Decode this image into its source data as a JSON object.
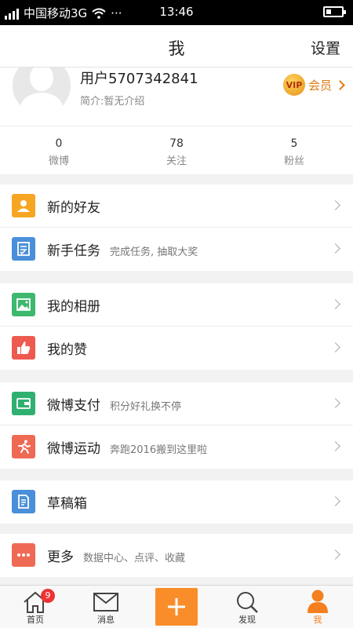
{
  "status_bar": {
    "carrier": "中国移动3G",
    "dots": "···",
    "time": "13:46",
    "battery_level": 0.2
  },
  "nav": {
    "title": "我",
    "settings": "设置"
  },
  "profile": {
    "username": "用户5707342841",
    "bio": "简介:暂无介绍",
    "vip_badge_text": "VIP",
    "vip_label": "会员"
  },
  "stats": [
    {
      "num": "0",
      "label": "微博"
    },
    {
      "num": "78",
      "label": "关注"
    },
    {
      "num": "5",
      "label": "粉丝"
    }
  ],
  "menu": [
    {
      "title": "新的好友",
      "subtitle": "",
      "icon": "new-friends-icon",
      "color": "#f6a623"
    },
    {
      "title": "新手任务",
      "subtitle": "完成任务, 抽取大奖",
      "icon": "task-icon",
      "color": "#4a8fd9"
    },
    {
      "title": "我的相册",
      "subtitle": "",
      "icon": "album-icon",
      "color": "#3db86e"
    },
    {
      "title": "我的赞",
      "subtitle": "",
      "icon": "like-icon",
      "color": "#ee5a4f"
    },
    {
      "title": "微博支付",
      "subtitle": "积分好礼换不停",
      "icon": "wallet-icon",
      "color": "#2fb071"
    },
    {
      "title": "微博运动",
      "subtitle": "奔跑2016搬到这里啦",
      "icon": "running-icon",
      "color": "#ee6a55"
    },
    {
      "title": "草稿箱",
      "subtitle": "",
      "icon": "drafts-icon",
      "color": "#4a8fd9"
    },
    {
      "title": "更多",
      "subtitle": "数据中心、点评、收藏",
      "icon": "more-icon",
      "color": "#ee6a55"
    }
  ],
  "tabbar": {
    "home_label": "首页",
    "home_badge": "9",
    "messages_label": "消息",
    "discover_label": "发现",
    "me_label": "我",
    "accent": "#f57f1f"
  }
}
